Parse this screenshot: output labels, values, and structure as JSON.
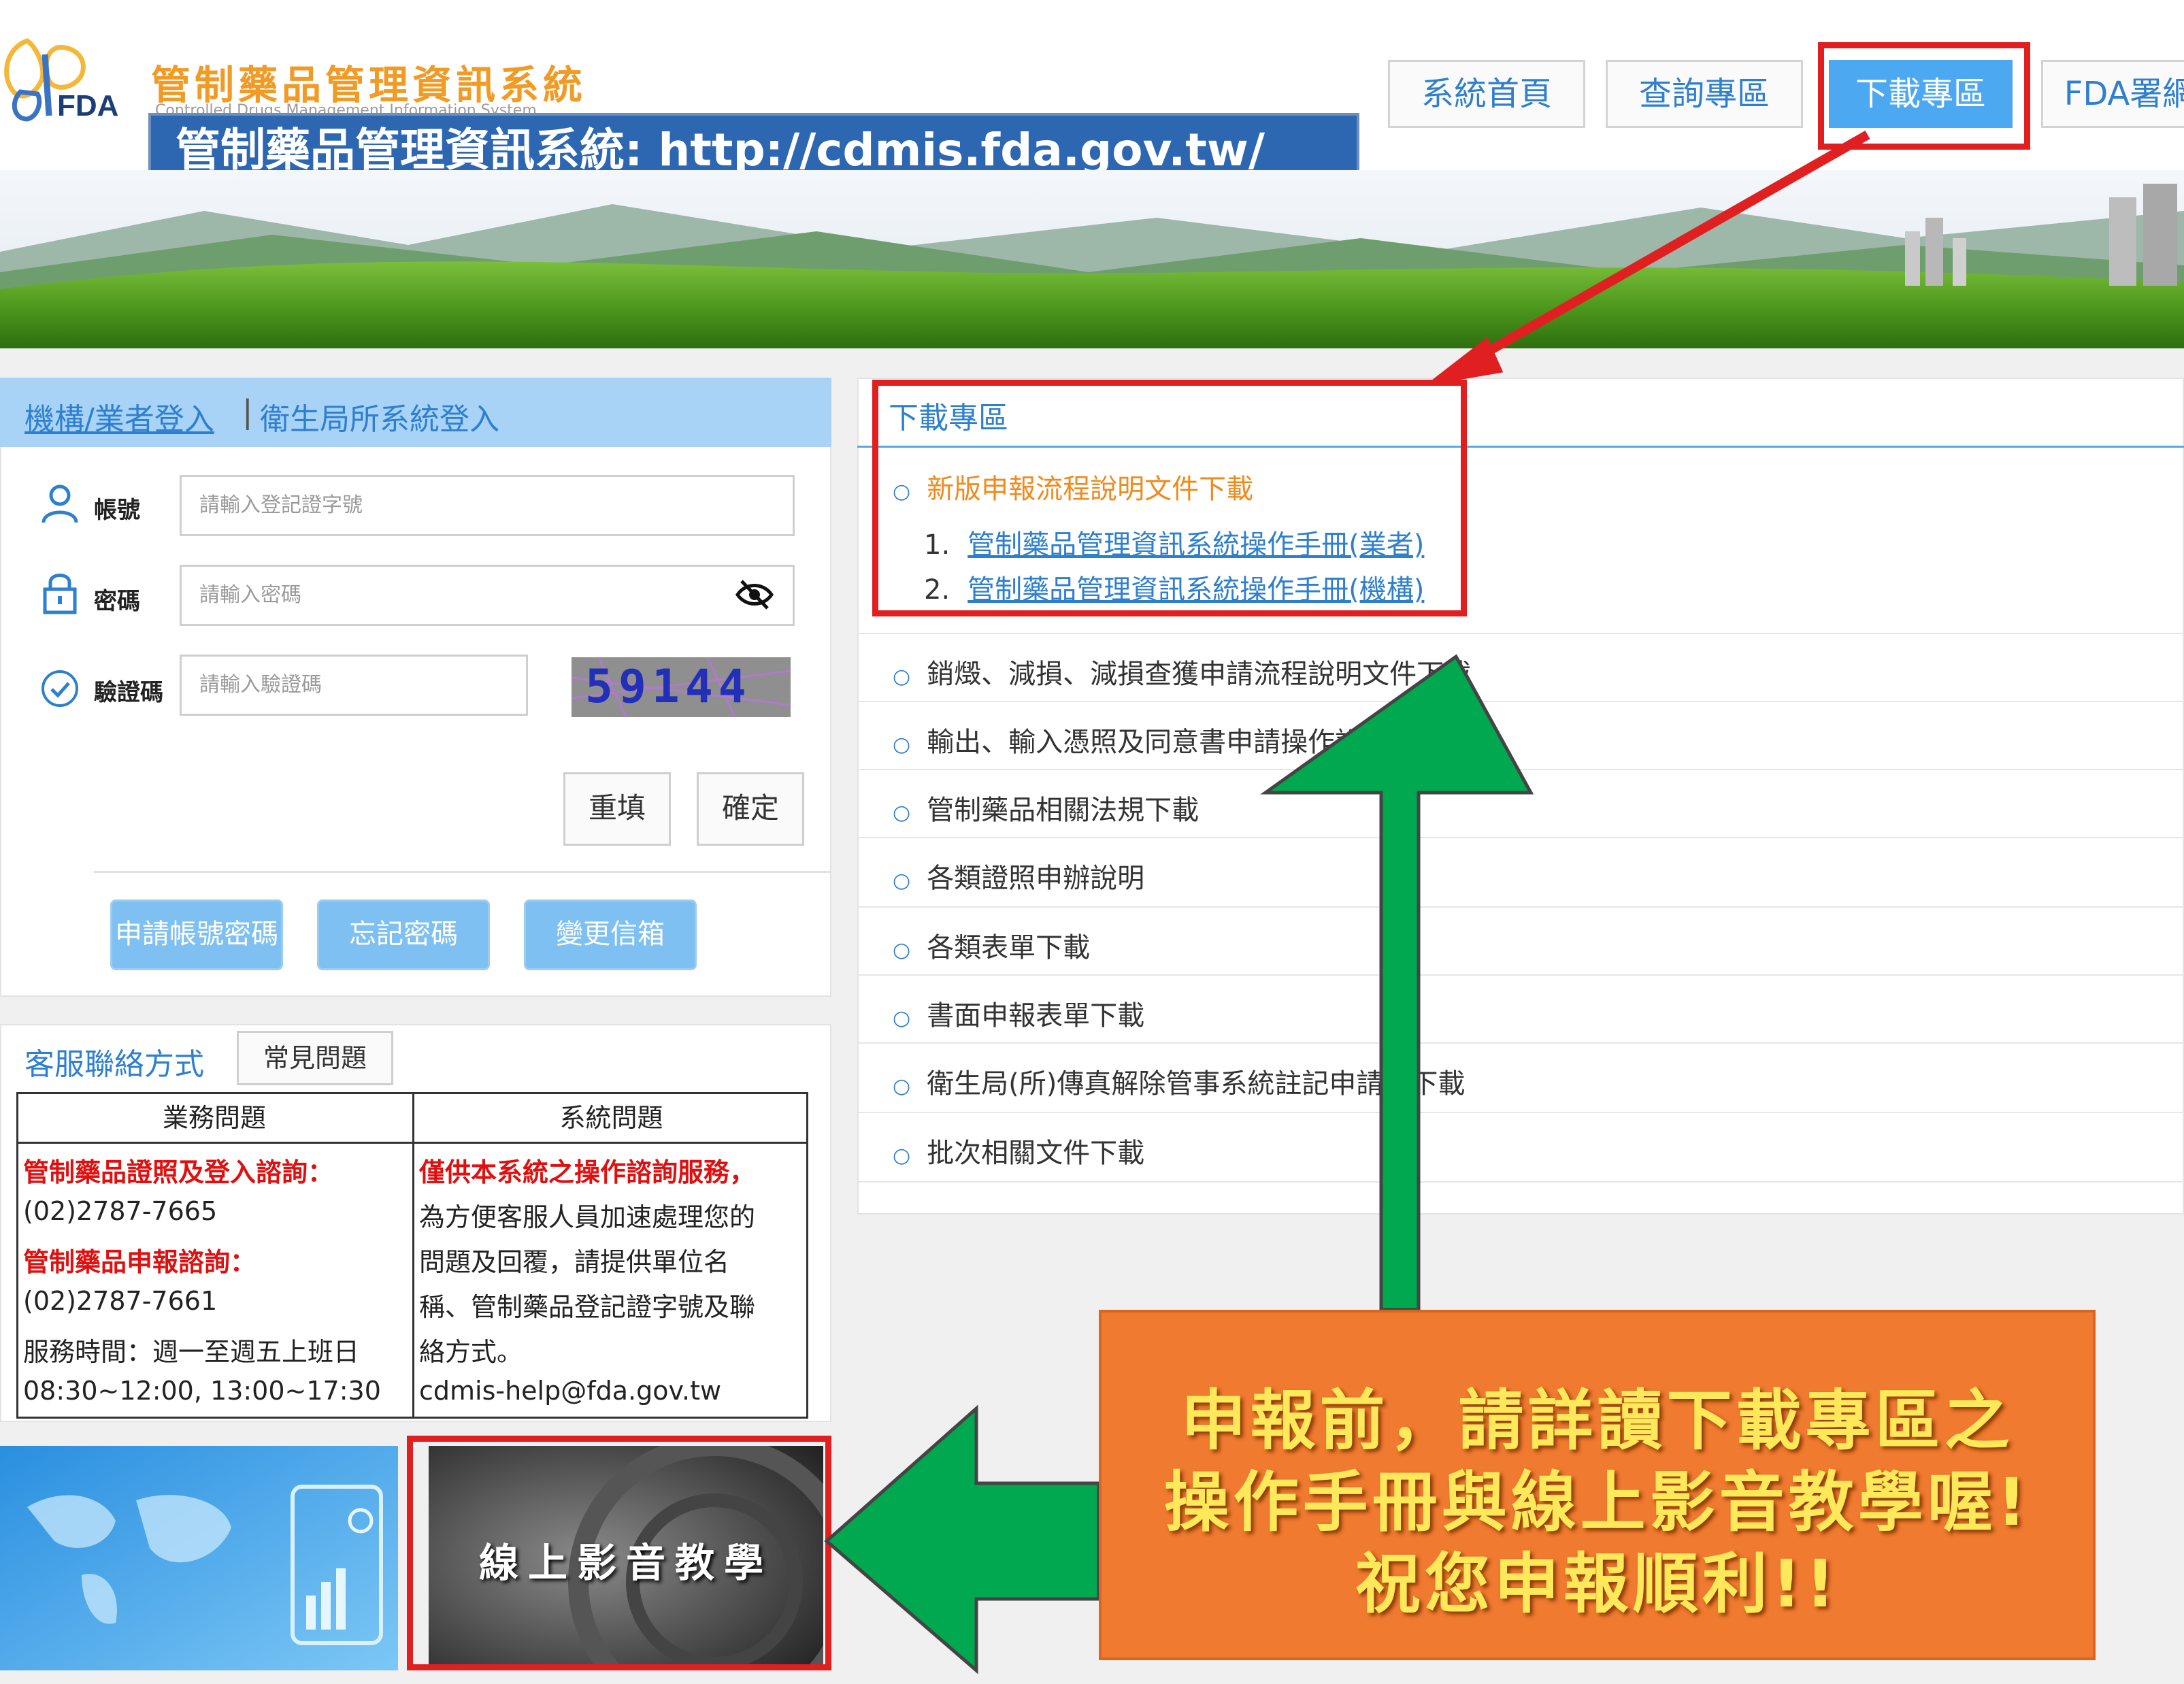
{
  "header": {
    "site_name": "管制藥品管理資訊系統",
    "site_subtitle": "Controlled Drugs Management Information System",
    "logo_text": "FDA",
    "url_banner": "管制藥品管理資訊系統: http://cdmis.fda.gov.tw/",
    "nav": [
      {
        "label": "系統首頁"
      },
      {
        "label": "查詢專區"
      },
      {
        "label": "下載專區"
      },
      {
        "label": "FDA署網"
      }
    ]
  },
  "login": {
    "tabs": {
      "org": "機構/業者登入",
      "separator": "|",
      "health": "衛生局所系統登入"
    },
    "account_label": "帳號",
    "account_placeholder": "請輸入登記證字號",
    "password_label": "密碼",
    "password_placeholder": "請輸入密碼",
    "captcha_label": "驗證碼",
    "captcha_placeholder": "請輸入驗證碼",
    "captcha_value": "59144",
    "reset_label": "重填",
    "confirm_label": "確定",
    "apply_label": "申請帳號密碼",
    "forgot_label": "忘記密碼",
    "change_email_label": "變更信箱"
  },
  "service": {
    "title": "客服聯絡方式",
    "faq_label": "常見問題",
    "col_business": "業務問題",
    "col_system": "系統問題",
    "business_lines": [
      {
        "text": "管制藥品證照及登入諮詢：",
        "red": true
      },
      {
        "text": "(02)2787-7665",
        "red": false
      },
      {
        "text": "管制藥品申報諮詢：",
        "red": true
      },
      {
        "text": "(02)2787-7661",
        "red": false
      },
      {
        "text": "服務時間：週一至週五上班日",
        "red": false
      },
      {
        "text": "08:30~12:00, 13:00~17:30",
        "red": false
      }
    ],
    "system_lines": [
      {
        "text": "僅供本系統之操作諮詢服務，",
        "red": true
      },
      {
        "text": "為方便客服人員加速處理您的",
        "red": false
      },
      {
        "text": "問題及回覆，請提供單位名",
        "red": false
      },
      {
        "text": "稱、管制藥品登記證字號及聯",
        "red": false
      },
      {
        "text": "絡方式。",
        "red": false
      },
      {
        "text": "cdmis-help@fda.gov.tw",
        "red": false
      }
    ]
  },
  "tiles": {
    "video_label": "線上影音教學"
  },
  "download": {
    "title": "下載專區",
    "new_section": "新版申報流程說明文件下載",
    "sub_links": [
      {
        "num": "1.",
        "label": "管制藥品管理資訊系統操作手冊(業者)"
      },
      {
        "num": "2.",
        "label": "管制藥品管理資訊系統操作手冊(機構)"
      }
    ],
    "items": [
      {
        "label": "銷燬、減損、減損查獲申請流程說明文件下載"
      },
      {
        "label": "輸出、輸入憑照及同意書申請操作說明"
      },
      {
        "label": "管制藥品相關法規下載"
      },
      {
        "label": "各類證照申辦說明"
      },
      {
        "label": "各類表單下載"
      },
      {
        "label": "書面申報表單下載"
      },
      {
        "label": "衛生局(所)傳真解除管事系統註記申請表下載"
      },
      {
        "label": "批次相關文件下載"
      }
    ]
  },
  "callout": {
    "lines": [
      "申報前，請詳讀下載專區之",
      "操作手冊與線上影音教學喔!",
      "祝您申報順利!!"
    ]
  },
  "colors": {
    "brand_orange": "#f19a24",
    "link_blue": "#2f7fcf",
    "banner_blue": "#2d67b1",
    "highlight_red": "#e02020",
    "arrow_green": "#00a84f",
    "callout_orange": "#ef7a30"
  }
}
